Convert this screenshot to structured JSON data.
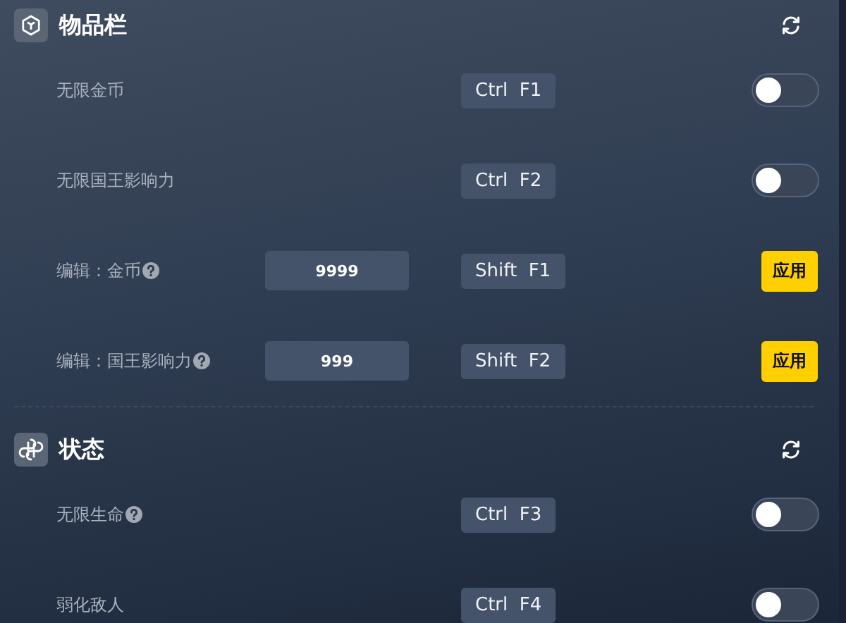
{
  "sections": [
    {
      "title": "物品栏",
      "rows": [
        {
          "kind": "toggle",
          "label": "无限金币",
          "help": false,
          "hotkey": "Ctrl  F1",
          "on": false
        },
        {
          "kind": "toggle",
          "label": "无限国王影响力",
          "help": false,
          "hotkey": "Ctrl  F2",
          "on": false
        },
        {
          "kind": "edit",
          "label": "编辑：金币",
          "help": true,
          "value": "9999",
          "hotkey": "Shift  F1",
          "button": "应用"
        },
        {
          "kind": "edit",
          "label": "编辑：国王影响力",
          "help": true,
          "value": "999",
          "hotkey": "Shift  F2",
          "button": "应用"
        }
      ]
    },
    {
      "title": "状态",
      "rows": [
        {
          "kind": "toggle",
          "label": "无限生命",
          "help": true,
          "hotkey": "Ctrl  F3",
          "on": false
        },
        {
          "kind": "toggle",
          "label": "弱化敌人",
          "help": false,
          "hotkey": "Ctrl  F4",
          "on": false
        }
      ]
    }
  ]
}
